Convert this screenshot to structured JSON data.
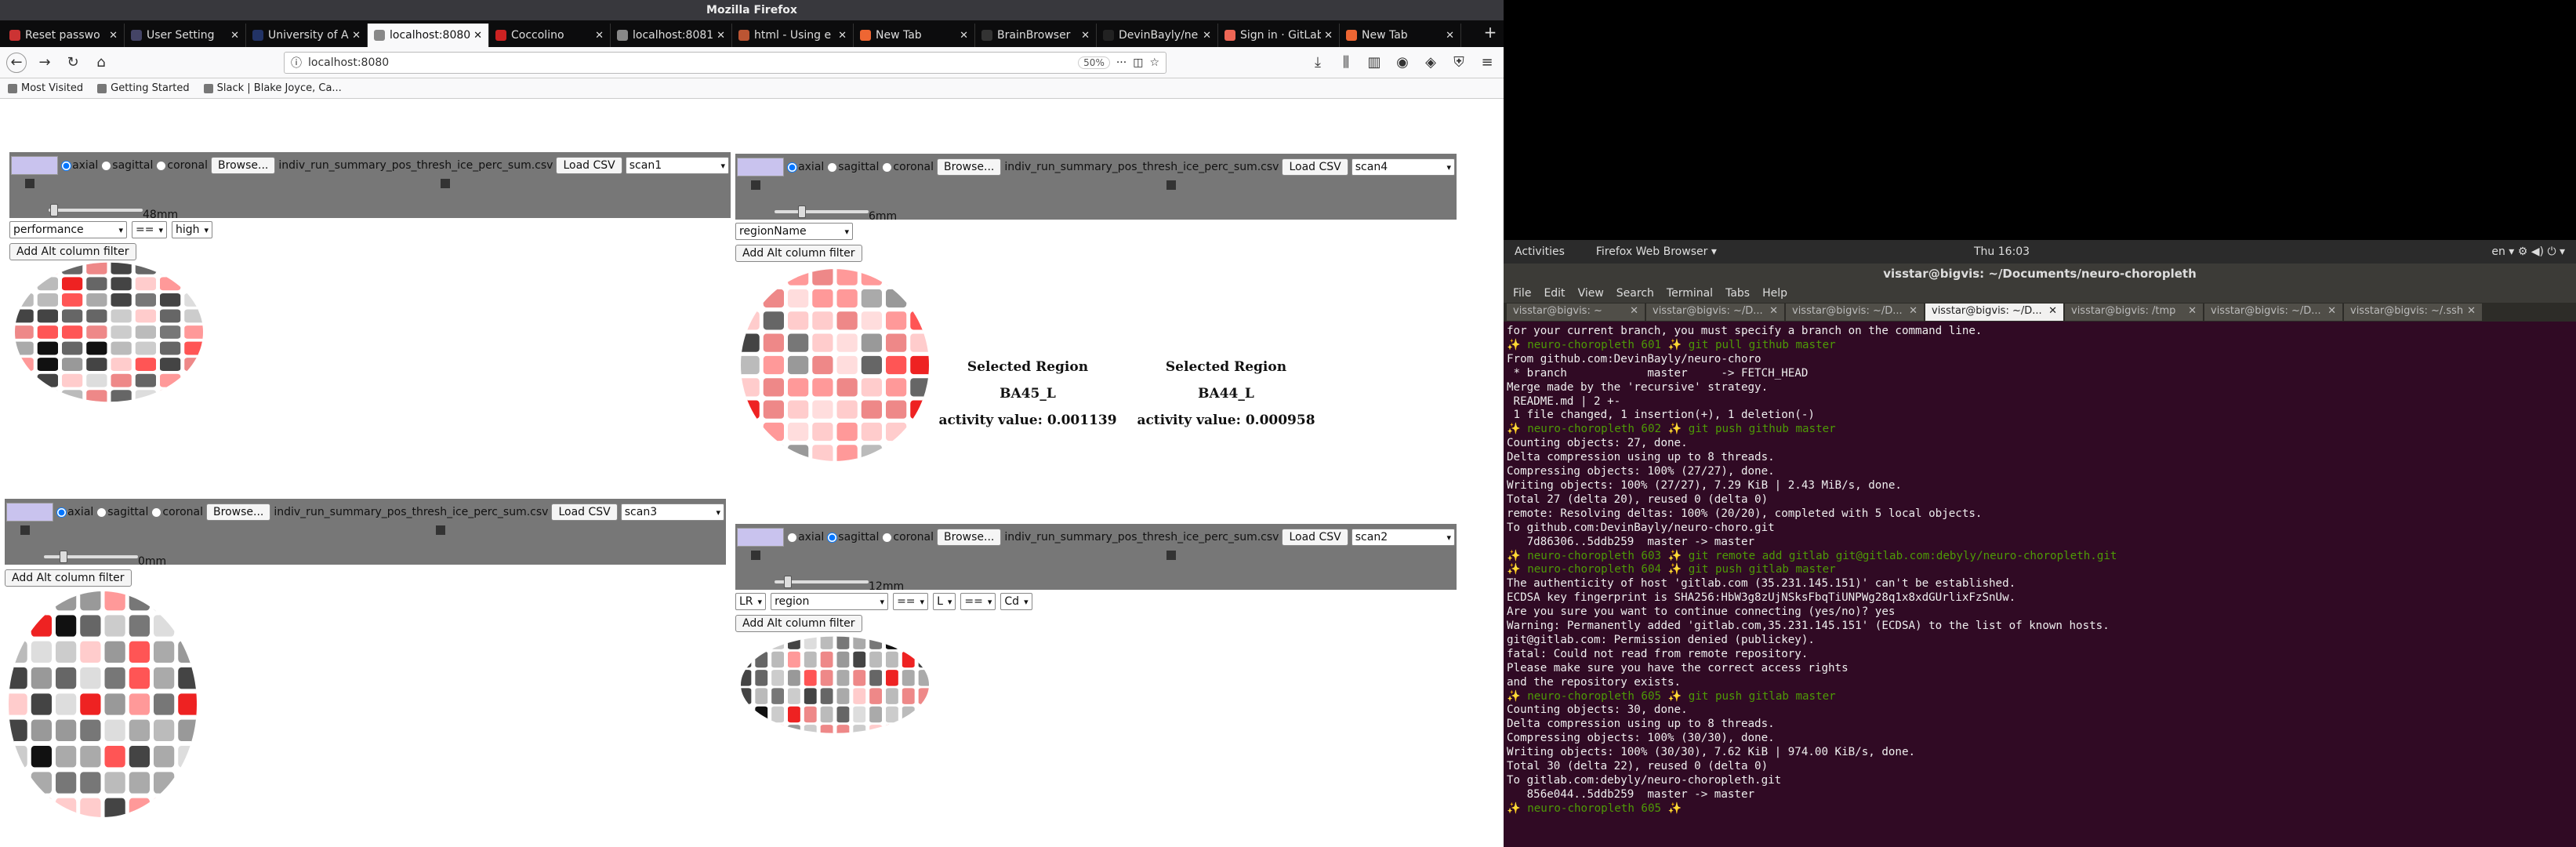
{
  "firefox": {
    "window_title": "Mozilla Firefox",
    "tabs": [
      {
        "label": "Reset passwo",
        "active": false
      },
      {
        "label": "User Setting",
        "active": false
      },
      {
        "label": "University of A",
        "active": false
      },
      {
        "label": "localhost:8080/",
        "active": true
      },
      {
        "label": "Coccolino",
        "active": false
      },
      {
        "label": "localhost:8081/",
        "active": false
      },
      {
        "label": "html - Using e",
        "active": false
      },
      {
        "label": "New Tab",
        "active": false
      },
      {
        "label": "BrainBrowser",
        "active": false
      },
      {
        "label": "DevinBayly/ne",
        "active": false
      },
      {
        "label": "Sign in · GitLab",
        "active": false
      },
      {
        "label": "New Tab",
        "active": false
      }
    ],
    "url": "localhost:8080",
    "zoom": "50%",
    "bookmarks": [
      "Most Visited",
      "Getting Started",
      "Slack | Blake Joyce, Ca..."
    ]
  },
  "app": {
    "panels": [
      {
        "views": [
          "axial",
          "sagittal",
          "coronal"
        ],
        "selected_view": "axial",
        "browse_label": "Browse...",
        "file_name": "indiv_run_summary_pos_thresh_ice_perc_sum.csv",
        "load_label": "Load CSV",
        "scan": "scan1",
        "slider_value": "48mm",
        "filters": [
          "performance",
          "==",
          "high"
        ],
        "add_filter_label": "Add Alt column filter"
      },
      {
        "views": [
          "axial",
          "sagittal",
          "coronal"
        ],
        "selected_view": "axial",
        "browse_label": "Browse...",
        "file_name": "indiv_run_summary_pos_thresh_ice_perc_sum.csv",
        "load_label": "Load CSV",
        "scan": "scan4",
        "slider_value": "6mm",
        "filters": [
          "regionName"
        ],
        "add_filter_label": "Add Alt column filter"
      },
      {
        "views": [
          "axial",
          "sagittal",
          "coronal"
        ],
        "selected_view": "axial",
        "browse_label": "Browse...",
        "file_name": "indiv_run_summary_pos_thresh_ice_perc_sum.csv",
        "load_label": "Load CSV",
        "scan": "scan3",
        "slider_value": "0mm",
        "filters": [],
        "add_filter_label": "Add Alt column filter"
      },
      {
        "views": [
          "axial",
          "sagittal",
          "coronal"
        ],
        "selected_view": "sagittal",
        "browse_label": "Browse...",
        "file_name": "indiv_run_summary_pos_thresh_ice_perc_sum.csv",
        "load_label": "Load CSV",
        "scan": "scan2",
        "slider_value": "12mm",
        "filters": [
          "LR",
          "region",
          "==",
          "L",
          "==",
          "Cd"
        ],
        "add_filter_label": "Add Alt column filter"
      }
    ],
    "selected_regions": [
      {
        "heading": "Selected Region",
        "name": "BA45_L",
        "activity": "activity value: 0.001139"
      },
      {
        "heading": "Selected Region",
        "name": "BA44_L",
        "activity": "activity value: 0.000958"
      }
    ]
  },
  "desktop": {
    "activities": "Activities",
    "app_menu": "Firefox Web Browser ▾",
    "clock": "Thu 16:03",
    "indicators": "en ▾   ⚙ ◀) ⏻ ▾"
  },
  "terminal": {
    "title": "visstar@bigvis: ~/Documents/neuro-choropleth",
    "menu": [
      "File",
      "Edit",
      "View",
      "Search",
      "Terminal",
      "Tabs",
      "Help"
    ],
    "tabs": [
      {
        "label": "visstar@bigvis: ~",
        "active": false
      },
      {
        "label": "visstar@bigvis: ~/D...",
        "active": false
      },
      {
        "label": "visstar@bigvis: ~/D...",
        "active": false
      },
      {
        "label": "visstar@bigvis: ~/D...",
        "active": true
      },
      {
        "label": "visstar@bigvis: /tmp",
        "active": false
      },
      {
        "label": "visstar@bigvis: ~/D...",
        "active": false
      },
      {
        "label": "visstar@bigvis: ~/.ssh",
        "active": false
      }
    ],
    "lines": [
      "for your current branch, you must specify a branch on the command line.",
      "✨ neuro-choropleth 601 ✨ git pull github master",
      "From github.com:DevinBayly/neuro-choro",
      " * branch            master     -> FETCH_HEAD",
      "Merge made by the 'recursive' strategy.",
      " README.md | 2 +-",
      " 1 file changed, 1 insertion(+), 1 deletion(-)",
      "✨ neuro-choropleth 602 ✨ git push github master",
      "Counting objects: 27, done.",
      "Delta compression using up to 8 threads.",
      "Compressing objects: 100% (27/27), done.",
      "Writing objects: 100% (27/27), 7.29 KiB | 2.43 MiB/s, done.",
      "Total 27 (delta 20), reused 0 (delta 0)",
      "remote: Resolving deltas: 100% (20/20), completed with 5 local objects.",
      "To github.com:DevinBayly/neuro-choro.git",
      "   7d86306..5ddb259  master -> master",
      "✨ neuro-choropleth 603 ✨ git remote add gitlab git@gitlab.com:debyly/neuro-choropleth.git",
      "✨ neuro-choropleth 604 ✨ git push gitlab master",
      "The authenticity of host 'gitlab.com (35.231.145.151)' can't be established.",
      "ECDSA key fingerprint is SHA256:HbW3g8zUjNSksFbqTiUNPWg28q1x8xdGUrlixFzSnUw.",
      "Are you sure you want to continue connecting (yes/no)? yes",
      "Warning: Permanently added 'gitlab.com,35.231.145.151' (ECDSA) to the list of known hosts.",
      "git@gitlab.com: Permission denied (publickey).",
      "fatal: Could not read from remote repository.",
      "",
      "Please make sure you have the correct access rights",
      "and the repository exists.",
      "✨ neuro-choropleth 605 ✨ git push gitlab master",
      "Counting objects: 30, done.",
      "Delta compression using up to 8 threads.",
      "Compressing objects: 100% (30/30), done.",
      "Writing objects: 100% (30/30), 7.62 KiB | 974.00 KiB/s, done.",
      "Total 30 (delta 22), reused 0 (delta 0)",
      "To gitlab.com:debyly/neuro-choropleth.git",
      "   856e044..5ddb259  master -> master",
      "✨ neuro-choropleth 605 ✨ "
    ]
  }
}
